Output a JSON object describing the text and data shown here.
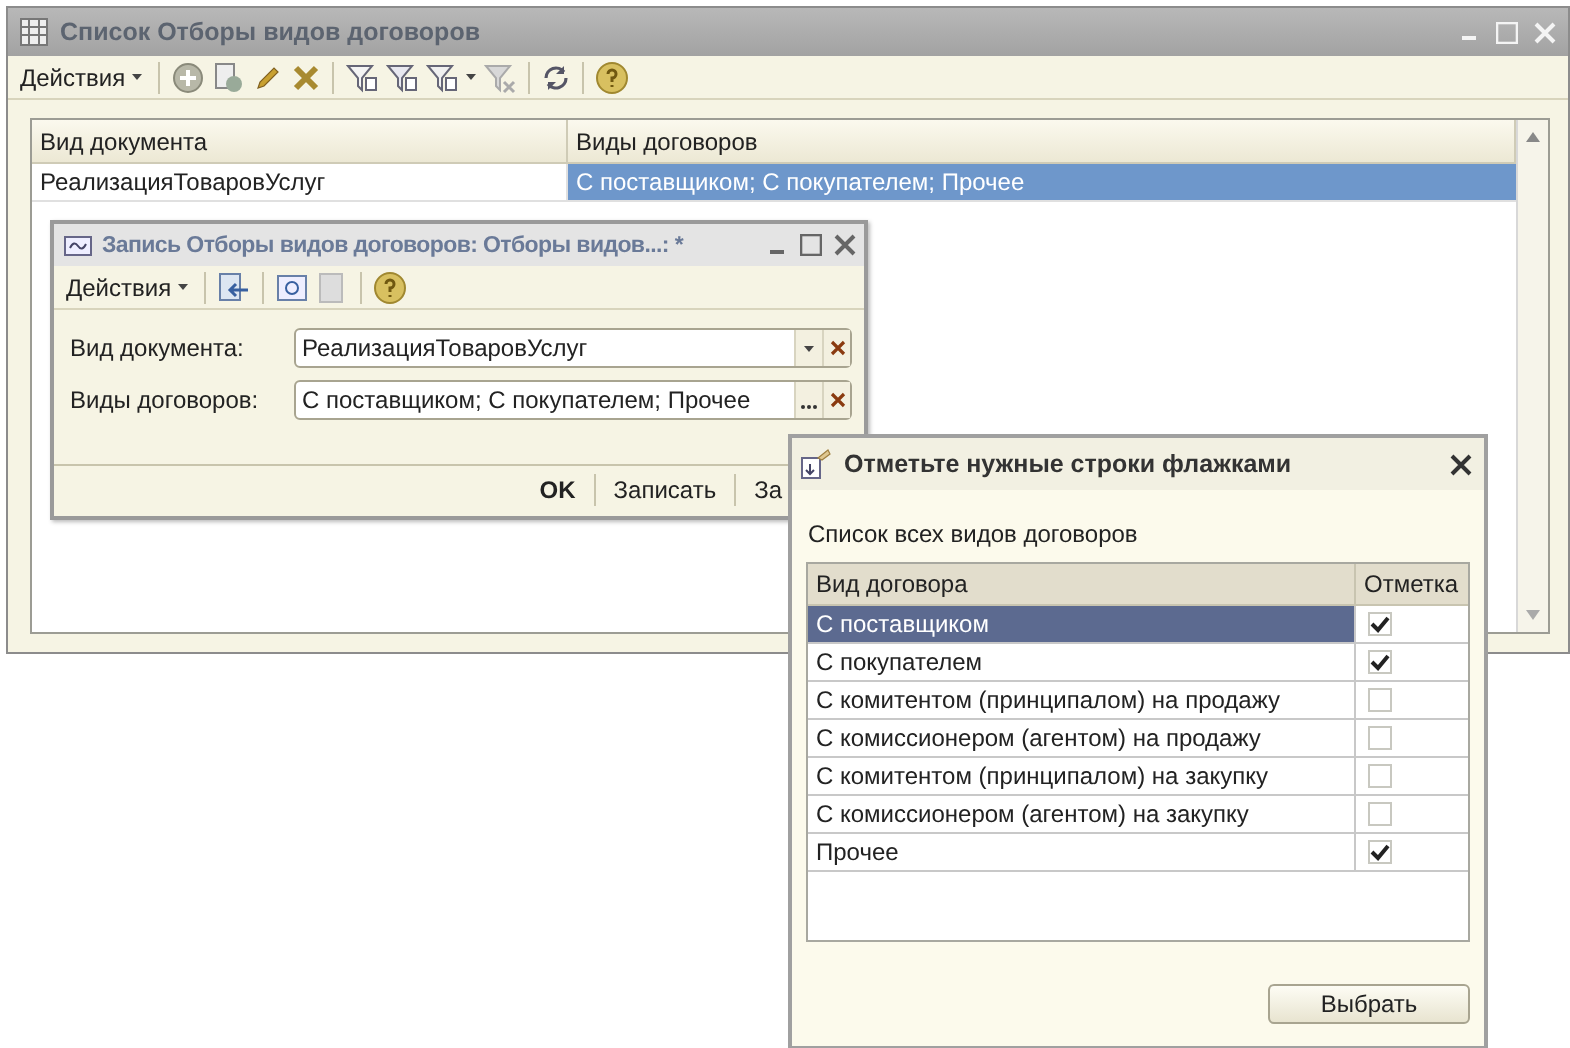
{
  "main_window": {
    "title": "Список Отборы видов договоров",
    "actions_menu": "Действия",
    "table": {
      "columns": [
        "Вид документа",
        "Виды договоров"
      ],
      "rows": [
        {
          "cells": [
            {
              "text": "РеализацияТоваровУслуг",
              "selected": false
            },
            {
              "text": "С поставщиком; С покупателем; Прочее",
              "selected": true
            }
          ]
        }
      ]
    }
  },
  "record_window": {
    "title": "Запись Отборы видов договоров: Отборы видов...: *",
    "actions_menu": "Действия",
    "fields": [
      {
        "label": "Вид документа:",
        "value": "РеализацияТоваровУслуг",
        "kind": "dropdown"
      },
      {
        "label": "Виды договоров:",
        "value": "С поставщиком; С покупателем; Прочее",
        "kind": "picker"
      }
    ],
    "buttons": [
      {
        "label": "OK",
        "default": true
      },
      {
        "label": "Записать",
        "default": false
      },
      {
        "label": "За",
        "default": false
      }
    ]
  },
  "dialog": {
    "title": "Отметьте нужные строки флажками",
    "caption": "Список всех видов договоров",
    "columns": [
      "Вид договора",
      "Отметка"
    ],
    "rows": [
      {
        "name": "С поставщиком",
        "checked": true,
        "selected": true
      },
      {
        "name": "С покупателем",
        "checked": true,
        "selected": false
      },
      {
        "name": "С комитентом (принципалом) на продажу",
        "checked": false,
        "selected": false
      },
      {
        "name": "С комиссионером (агентом) на продажу",
        "checked": false,
        "selected": false
      },
      {
        "name": "С комитентом (принципалом) на закупку",
        "checked": false,
        "selected": false
      },
      {
        "name": "С комиссионером (агентом) на закупку",
        "checked": false,
        "selected": false
      },
      {
        "name": "Прочее",
        "checked": true,
        "selected": false
      }
    ],
    "button": "Выбрать"
  }
}
